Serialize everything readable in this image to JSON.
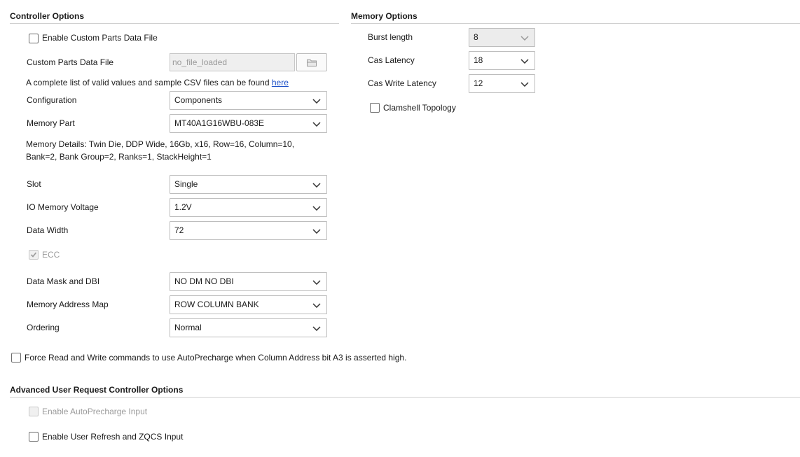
{
  "controller": {
    "title": "Controller Options",
    "enable_custom_parts_label": "Enable Custom Parts Data File",
    "custom_parts_label": "Custom Parts Data File",
    "custom_parts_value": "no_file_loaded",
    "info_text": "A complete list of valid values and sample CSV files can be found ",
    "info_link": "here",
    "configuration_label": "Configuration",
    "configuration_value": "Components",
    "memory_part_label": "Memory Part",
    "memory_part_value": "MT40A1G16WBU-083E",
    "memory_details_line1": "Memory Details: Twin Die, DDP Wide, 16Gb, x16, Row=16, Column=10,",
    "memory_details_line2": "Bank=2, Bank Group=2, Ranks=1, StackHeight=1",
    "slot_label": "Slot",
    "slot_value": "Single",
    "io_voltage_label": "IO Memory Voltage",
    "io_voltage_value": "1.2V",
    "data_width_label": "Data Width",
    "data_width_value": "72",
    "ecc_label": "ECC",
    "ecc_checked": true,
    "data_mask_label": "Data Mask and DBI",
    "data_mask_value": "NO DM NO DBI",
    "address_map_label": "Memory Address Map",
    "address_map_value": "ROW COLUMN BANK",
    "ordering_label": "Ordering",
    "ordering_value": "Normal"
  },
  "memory": {
    "title": "Memory Options",
    "burst_length_label": "Burst length",
    "burst_length_value": "8",
    "cas_latency_label": "Cas Latency",
    "cas_latency_value": "18",
    "cas_write_latency_label": "Cas Write Latency",
    "cas_write_latency_value": "12",
    "clamshell_label": "Clamshell Topology"
  },
  "force_autoprecharge_label": "Force Read and Write commands to use AutoPrecharge when Column Address bit A3 is asserted high.",
  "advanced": {
    "title": "Advanced User Request Controller Options",
    "enable_autoprecharge_label": "Enable AutoPrecharge Input",
    "enable_refresh_label": "Enable User Refresh and ZQCS Input"
  },
  "icons": {
    "dropdown": "chevron-down-icon",
    "browse": "folder-icon",
    "check": "check-icon"
  }
}
